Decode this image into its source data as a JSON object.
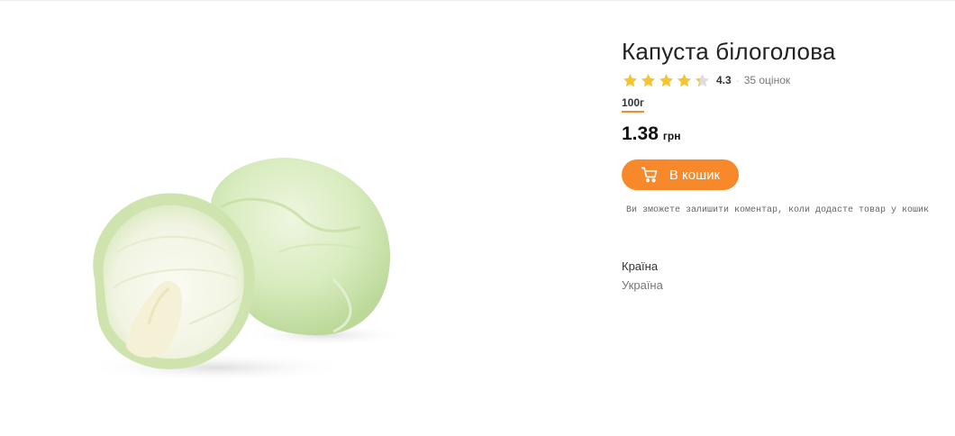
{
  "product": {
    "title": "Капуста білоголова",
    "image_alt": "cabbage-image",
    "rating": {
      "stars": 4.3,
      "max_stars": 5,
      "value_text": "4.3",
      "separator": "·",
      "count_text": "35 оцінок"
    },
    "weight_option": "100г",
    "price": "1.38",
    "currency": "грн",
    "add_to_cart_label": "В кошик",
    "comment_hint": "Ви зможете залишити коментар, коли додасте товар у кошик",
    "attributes": [
      {
        "label": "Країна",
        "value": "Україна"
      }
    ]
  },
  "colors": {
    "accent": "#f7892b",
    "star_filled": "#f4c531",
    "star_empty": "#dcdcdc"
  },
  "icons": {
    "cart": "shopping-cart-icon",
    "star": "star-icon"
  }
}
